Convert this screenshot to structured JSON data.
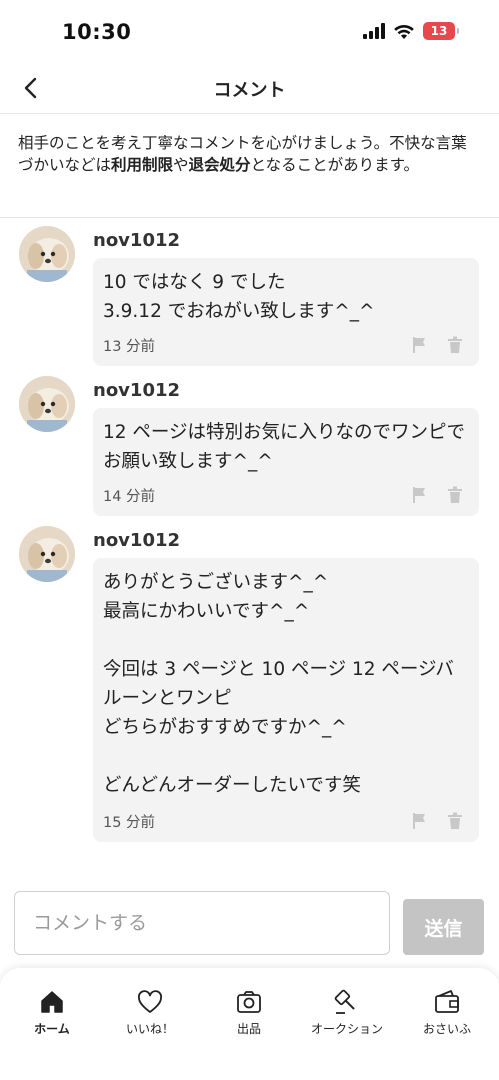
{
  "status_bar": {
    "time": "10:30",
    "battery": "13"
  },
  "header": {
    "title": "コメント"
  },
  "notice": {
    "text_before": "相手のことを考え丁寧なコメントを心がけましょう。不快な言葉づかいなどは",
    "term1": "利用制限",
    "mid": "や",
    "term2": "退会処分",
    "text_after": "となることがあります。"
  },
  "comments": [
    {
      "username": "nov1012",
      "text": "10 ではなく 9 でした\n3.9.12 でおねがい致します^_^",
      "time": "13 分前"
    },
    {
      "username": "nov1012",
      "text": "12 ページは特別お気に入りなのでワンピでお願い致します^_^",
      "time": "14 分前"
    },
    {
      "username": "nov1012",
      "text": "ありがとうございます^_^\n最高にかわいいです^_^\n\n今回は 3 ページと 10 ページ 12 ページバルーンとワンピ\nどちらがおすすめですか^_^\n\nどんどんオーダーしたいです笑",
      "time": "15 分前"
    }
  ],
  "input": {
    "placeholder": "コメントする",
    "value": "",
    "send_label": "送信"
  },
  "nav": [
    {
      "label": "ホーム",
      "icon": "home-icon",
      "active": true
    },
    {
      "label": "いいね！",
      "icon": "heart-icon"
    },
    {
      "label": "出品",
      "icon": "camera-icon"
    },
    {
      "label": "オークション",
      "icon": "gavel-icon"
    },
    {
      "label": "おさいふ",
      "icon": "wallet-icon"
    }
  ],
  "colors": {
    "battery": "#e8474c",
    "bubble": "#f3f3f3",
    "send_button": "#c4c4c4"
  }
}
